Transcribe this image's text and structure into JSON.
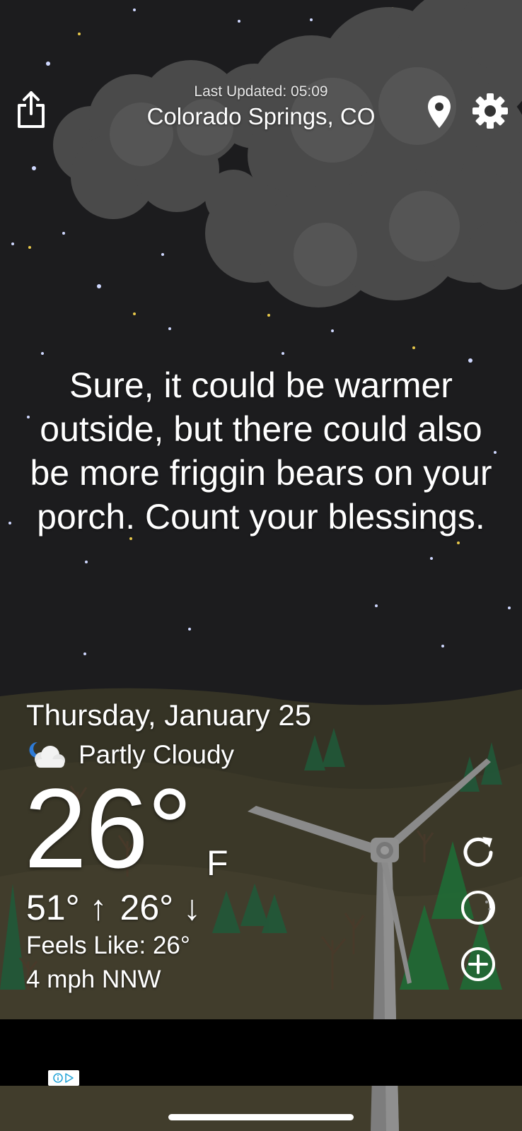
{
  "header": {
    "last_updated": "Last Updated: 05:09",
    "location": "Colorado Springs, CO"
  },
  "icons": {
    "share": "share-icon",
    "location": "location-pin-icon",
    "settings": "gear-icon",
    "condition": "partly-cloudy-night-icon",
    "refresh": "refresh-icon",
    "moon": "moon-phase-icon",
    "add": "add-icon",
    "ad_choices": "ad-choices-icon"
  },
  "message": "Sure, it could be warmer outside, but there could also be more friggin bears on your porch. Count your blessings.",
  "weather": {
    "date": "Thursday, January 25",
    "condition": "Partly Cloudy",
    "temperature": "26°",
    "unit": "F",
    "high": "51° ↑",
    "low": "26° ↓",
    "feels_like": "Feels Like: 26°",
    "wind": "4 mph NNW"
  },
  "colors": {
    "sky": "#1c1c1e",
    "ground": "#3a3626",
    "cloud": "#555555",
    "ad_bar": "#000000"
  }
}
